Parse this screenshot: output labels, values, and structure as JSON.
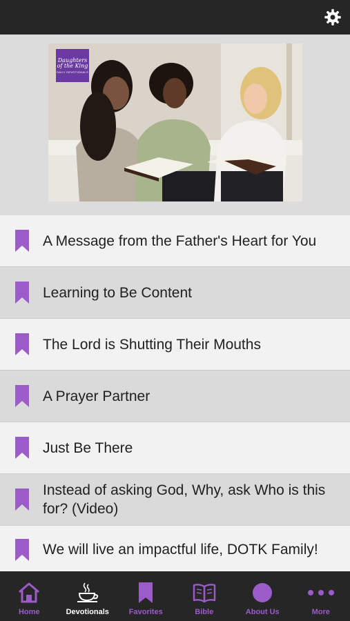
{
  "header": {
    "settings_icon": "gear-icon"
  },
  "hero": {
    "logo_line1": "Daughters of the King",
    "logo_line2": "DAILY DEVOTIONALS"
  },
  "devotionals": [
    {
      "title": "A Message from the Father's Heart for You",
      "icon": "bookmark-icon"
    },
    {
      "title": "Learning to Be Content",
      "icon": "bookmark-icon"
    },
    {
      "title": "The Lord is Shutting Their Mouths",
      "icon": "bookmark-icon"
    },
    {
      "title": "A Prayer Partner",
      "icon": "bookmark-icon"
    },
    {
      "title": "Just Be There",
      "icon": "bookmark-icon"
    },
    {
      "title": "Instead of asking God, Why, ask Who is this for? (Video)",
      "icon": "bookmark-icon"
    },
    {
      "title": "We will live an impactful life, DOTK Family!",
      "icon": "bookmark-icon"
    }
  ],
  "tabs": [
    {
      "label": "Home",
      "icon": "home-icon"
    },
    {
      "label": "Devotionals",
      "icon": "coffee-cup-icon",
      "active": true
    },
    {
      "label": "Favorites",
      "icon": "bookmark-icon"
    },
    {
      "label": "Bible",
      "icon": "open-book-icon"
    },
    {
      "label": "About Us",
      "icon": "circle-icon"
    },
    {
      "label": "More",
      "icon": "more-dots-icon"
    }
  ],
  "colors": {
    "accent": "#9b5bc8",
    "bar": "#262626",
    "row_light": "#f2f2f2",
    "row_dark": "#dadada"
  }
}
